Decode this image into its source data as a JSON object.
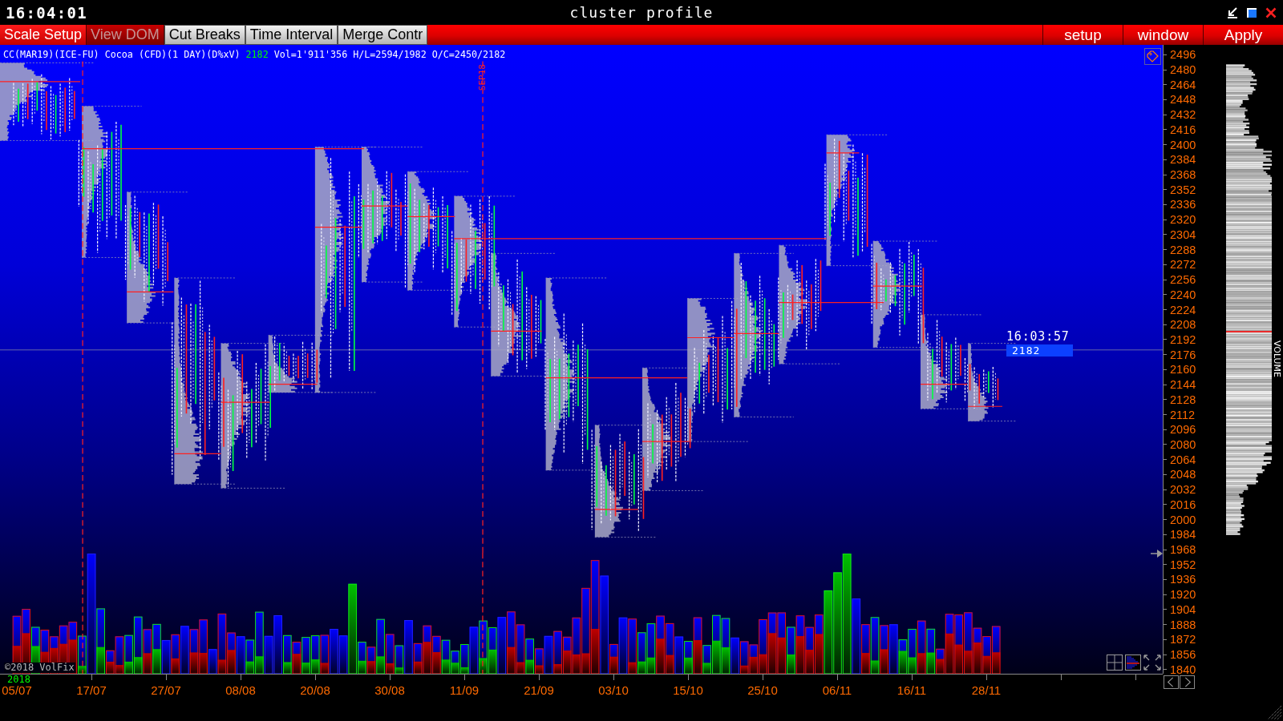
{
  "title_bar": {
    "clock": "16:04:01",
    "title": "cluster profile"
  },
  "toolbar": {
    "left_buttons": [
      {
        "label": "Scale Setup",
        "kind": "menu",
        "disabled": false
      },
      {
        "label": "View DOM",
        "kind": "menu",
        "disabled": true
      },
      {
        "label": "Cut Breaks",
        "kind": "toggle",
        "disabled": false
      },
      {
        "label": "Time Interval",
        "kind": "toggle",
        "disabled": false
      },
      {
        "label": "Merge Contr",
        "kind": "toggle",
        "disabled": false
      }
    ],
    "right_buttons": [
      "setup",
      "window",
      "Apply"
    ]
  },
  "chart": {
    "instrument": "CC(MAR19)(ICE-FU) Cocoa (CFD)(1 DAY)(D%xV)",
    "last_price": "2182",
    "stats": "Vol=1'911'356 H/L=2594/1982 O/C=2450/2182",
    "rollover_label": "SEP18",
    "price_marker": {
      "time": "16:03:57",
      "price": "2182"
    },
    "copyright": "©2018 VolFix"
  },
  "price_axis": {
    "ticks": [
      "2496",
      "2480",
      "2464",
      "2448",
      "2432",
      "2416",
      "2400",
      "2384",
      "2368",
      "2352",
      "2336",
      "2320",
      "2304",
      "2288",
      "2272",
      "2256",
      "2240",
      "2224",
      "2208",
      "2192",
      "2176",
      "2160",
      "2144",
      "2128",
      "2112",
      "2096",
      "2080",
      "2064",
      "2048",
      "2032",
      "2016",
      "2000",
      "1984",
      "1968",
      "1952",
      "1936",
      "1920",
      "1904",
      "1888",
      "1872",
      "1856",
      "1840"
    ]
  },
  "volume_profile": {
    "title": "VOLUME"
  },
  "date_axis": {
    "year": "2018",
    "labels": [
      "05/07",
      "17/07",
      "27/07",
      "08/08",
      "20/08",
      "30/08",
      "11/09",
      "21/09",
      "03/10",
      "15/10",
      "25/10",
      "06/11",
      "16/11",
      "28/11"
    ]
  }
}
